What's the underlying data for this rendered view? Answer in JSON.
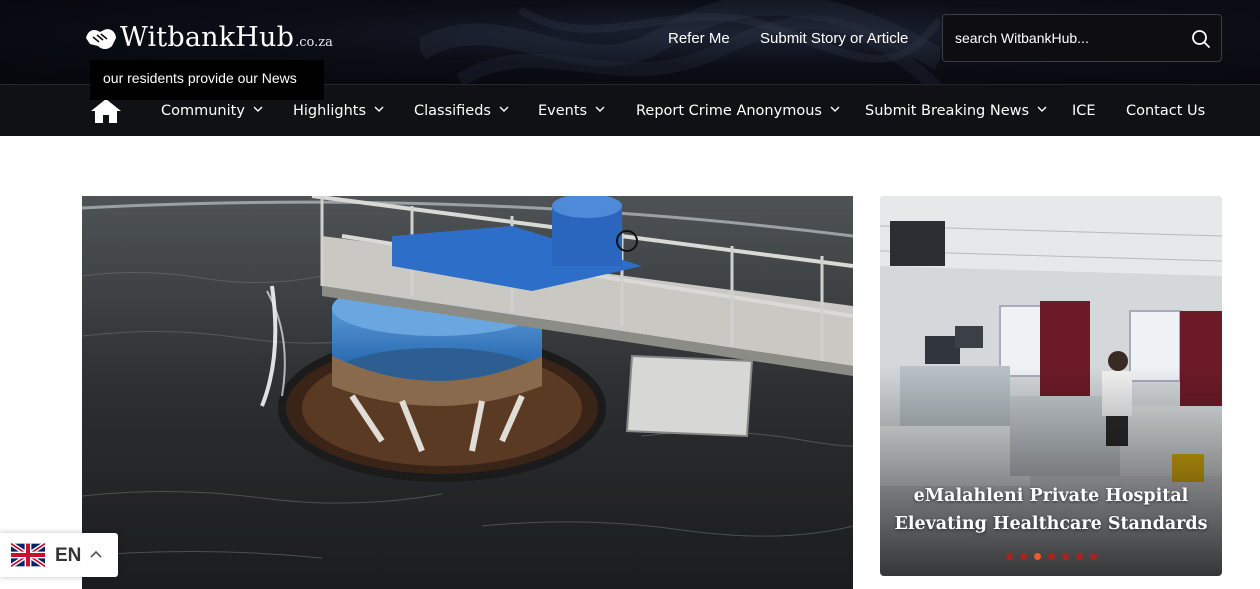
{
  "header": {
    "logo_text": "WitbankHub",
    "logo_tld": ".co.za",
    "tagline": "our residents provide our News",
    "links": [
      "Refer Me",
      "Submit Story or Article"
    ],
    "search_placeholder": "search WitbankHub..."
  },
  "nav": {
    "items": [
      {
        "label": "Community",
        "has_dropdown": true
      },
      {
        "label": "Highlights",
        "has_dropdown": true
      },
      {
        "label": "Classifieds",
        "has_dropdown": true
      },
      {
        "label": "Events",
        "has_dropdown": true
      },
      {
        "label": "Report Crime Anonymous",
        "has_dropdown": true
      },
      {
        "label": "Submit Breaking News",
        "has_dropdown": true
      },
      {
        "label": "ICE",
        "has_dropdown": false
      },
      {
        "label": "Contact Us",
        "has_dropdown": false
      }
    ]
  },
  "slider": {
    "caption_line1": "eMalahleni Private Hospital",
    "caption_line2": "Elevating Healthcare Standards",
    "dot_count": 7,
    "active_dot": 3,
    "dot_color": "#a8241e",
    "active_dot_color": "#f05a28"
  },
  "language": {
    "code": "EN"
  },
  "icons": [
    "home-icon",
    "search-icon",
    "chevron-down-icon",
    "uk-flag-icon",
    "chevron-up-icon"
  ]
}
